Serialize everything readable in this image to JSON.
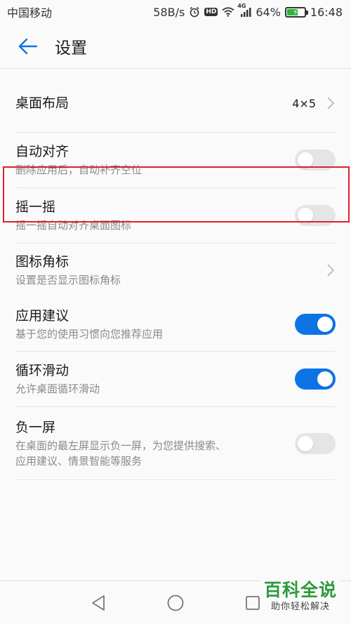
{
  "status_bar": {
    "carrier": "中国移动",
    "net_speed": "58B/s",
    "hd_badge": "HD",
    "network_type": "4G",
    "battery": "64%",
    "battery_level": 0.64,
    "time": "16:48"
  },
  "header": {
    "title": "设置",
    "back_icon": "arrow-left-icon"
  },
  "settings": [
    {
      "key": "desktop-layout",
      "title": "桌面布局",
      "value": "4×5",
      "control": "chevron"
    },
    {
      "key": "auto-align",
      "title": "自动对齐",
      "subtitle": "删除应用后，自动补齐空位",
      "control": "toggle",
      "on": false
    },
    {
      "key": "shake",
      "title": "摇一摇",
      "subtitle": "摇一摇自动对齐桌面图标",
      "control": "toggle",
      "on": false
    },
    {
      "key": "icon-badge",
      "title": "图标角标",
      "subtitle": "设置是否显示图标角标",
      "control": "chevron",
      "highlighted": true
    },
    {
      "key": "app-suggestions",
      "title": "应用建议",
      "subtitle": "基于您的使用习惯向您推荐应用",
      "control": "toggle",
      "on": true
    },
    {
      "key": "loop-scroll",
      "title": "循环滑动",
      "subtitle": "允许桌面循环滑动",
      "control": "toggle",
      "on": true
    },
    {
      "key": "minus-one-screen",
      "title": "负一屏",
      "subtitle": "在桌面的最左屏显示负一屏，为您提供搜索、",
      "subtitle2": "应用建议、情景智能等服务",
      "control": "toggle",
      "on": false
    }
  ],
  "watermark": {
    "main": "百科全说",
    "sub": "助你轻松解决"
  },
  "colors": {
    "accent": "#0d74e6",
    "highlight": "#e0202a",
    "watermark_green": "#2e9a3c"
  }
}
